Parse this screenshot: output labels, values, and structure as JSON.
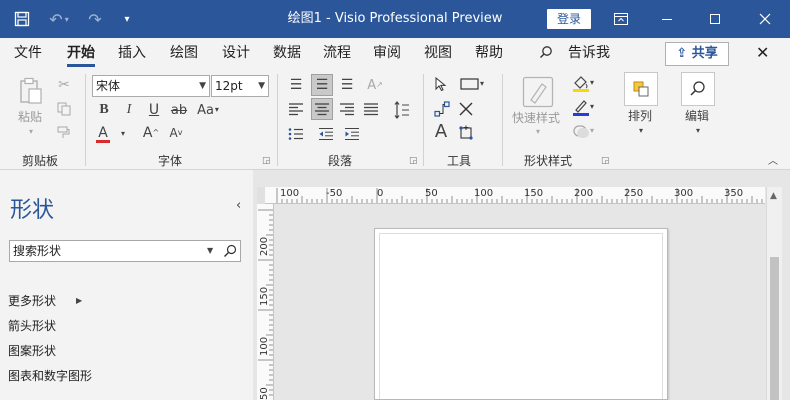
{
  "window": {
    "title": "绘图1 - Visio Professional Preview",
    "login_label": "登录"
  },
  "menu": {
    "items": [
      "文件",
      "开始",
      "插入",
      "绘图",
      "设计",
      "数据",
      "流程",
      "审阅",
      "视图",
      "帮助"
    ],
    "tell_me": "告诉我",
    "share_label": "共享"
  },
  "ribbon": {
    "clipboard": {
      "paste_label": "粘贴",
      "group_label": "剪贴板"
    },
    "font": {
      "font_name": "宋体",
      "font_size": "12pt",
      "group_label": "字体"
    },
    "paragraph": {
      "group_label": "段落"
    },
    "tools": {
      "group_label": "工具"
    },
    "shape_styles": {
      "quick_styles_label": "快速样式",
      "group_label": "形状样式"
    },
    "arrange": {
      "label": "排列"
    },
    "editing": {
      "label": "编辑"
    }
  },
  "shapes_pane": {
    "title": "形状",
    "search_placeholder": "搜索形状",
    "links": [
      "更多形状",
      "箭头形状",
      "图案形状",
      "图表和数字图形"
    ]
  },
  "ruler": {
    "h_labels": [
      "100",
      "-50",
      "0",
      "50",
      "100",
      "150",
      "200",
      "250",
      "300",
      "350"
    ],
    "v_labels": [
      "200",
      "150",
      "100",
      "50"
    ]
  }
}
